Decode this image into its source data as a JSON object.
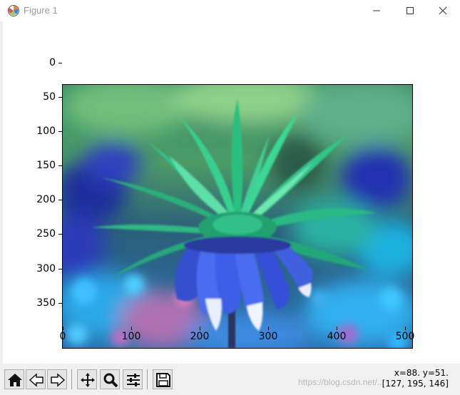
{
  "window": {
    "title": "Figure 1",
    "controls": [
      "minimize-icon",
      "maximize-icon",
      "close-icon"
    ]
  },
  "axes": {
    "y_ticks": [
      "0",
      "50",
      "100",
      "150",
      "200",
      "250",
      "300",
      "350"
    ],
    "x_ticks": [
      "0",
      "100",
      "200",
      "300",
      "400",
      "500"
    ],
    "x_range": [
      0,
      510
    ],
    "y_range": [
      0,
      383
    ],
    "image_description_colors": {
      "petals": "#3b63e0",
      "leaves": "#1fa36a",
      "background": "#2f6fa0"
    }
  },
  "toolbar": {
    "buttons": [
      "home-icon",
      "back-icon",
      "forward-icon",
      "pan-icon",
      "zoom-icon",
      "configure-subplots-icon",
      "save-icon"
    ]
  },
  "status": {
    "coords": "x=88. y=51.",
    "pixel": "[127, 195, 146]"
  },
  "watermark": "https://blog.csdn.net/..."
}
